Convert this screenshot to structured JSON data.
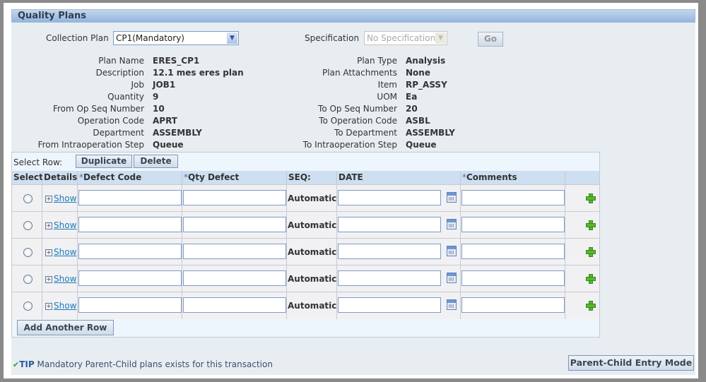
{
  "region_title": "Quality Plans",
  "collection_plan": {
    "label": "Collection Plan",
    "value": "CP1(Mandatory)"
  },
  "specification": {
    "label": "Specification",
    "value": "No Specification",
    "go_label": "Go"
  },
  "details_left": [
    {
      "label": "Plan Name",
      "value": "ERES_CP1"
    },
    {
      "label": "Description",
      "value": "12.1 mes eres plan"
    },
    {
      "label": "Job",
      "value": "JOB1"
    },
    {
      "label": "Quantity",
      "value": "9"
    },
    {
      "label": "From Op Seq Number",
      "value": "10"
    },
    {
      "label": "Operation Code",
      "value": "APRT"
    },
    {
      "label": "Department",
      "value": "ASSEMBLY"
    },
    {
      "label": "From Intraoperation Step",
      "value": "Queue"
    }
  ],
  "details_right": [
    {
      "label": "Plan Type",
      "value": "Analysis"
    },
    {
      "label": "Plan Attachments",
      "value": "None"
    },
    {
      "label": "Item",
      "value": "RP_ASSY"
    },
    {
      "label": "UOM",
      "value": "Ea"
    },
    {
      "label": "To Op Seq Number",
      "value": "20"
    },
    {
      "label": "To Operation Code",
      "value": "ASBL"
    },
    {
      "label": "To Department",
      "value": "ASSEMBLY"
    },
    {
      "label": "To Intraoperation Step",
      "value": "Queue"
    }
  ],
  "table": {
    "select_row_label": "Select Row:",
    "duplicate_label": "Duplicate",
    "delete_label": "Delete",
    "columns": {
      "select": "Select",
      "details": "Details",
      "defect_code_req": "*",
      "defect_code": "Defect Code",
      "qty_defect_req": "*",
      "qty_defect": "Qty Defect",
      "seq": "SEQ:",
      "date": "DATE",
      "comments_req": "*",
      "comments": "Comments"
    },
    "rows": [
      {
        "show_label": "Show",
        "seq": "Automatic",
        "defect_code": "",
        "qty_defect": "",
        "date": "",
        "comments": ""
      },
      {
        "show_label": "Show",
        "seq": "Automatic",
        "defect_code": "",
        "qty_defect": "",
        "date": "",
        "comments": ""
      },
      {
        "show_label": "Show",
        "seq": "Automatic",
        "defect_code": "",
        "qty_defect": "",
        "date": "",
        "comments": ""
      },
      {
        "show_label": "Show",
        "seq": "Automatic",
        "defect_code": "",
        "qty_defect": "",
        "date": "",
        "comments": ""
      },
      {
        "show_label": "Show",
        "seq": "Automatic",
        "defect_code": "",
        "qty_defect": "",
        "date": "",
        "comments": ""
      }
    ],
    "add_row_label": "Add Another Row"
  },
  "tip": {
    "label": "TIP",
    "text": "Mandatory Parent-Child plans exists for this transaction"
  },
  "parent_child_button": "Parent-Child Entry Mode",
  "colors": {
    "header_gradient_top": "#c4d6ec",
    "header_gradient_bottom": "#93b6de",
    "panel_bg": "#e8edf2",
    "link": "#1a7ab9",
    "add_icon": "#59b52f"
  }
}
